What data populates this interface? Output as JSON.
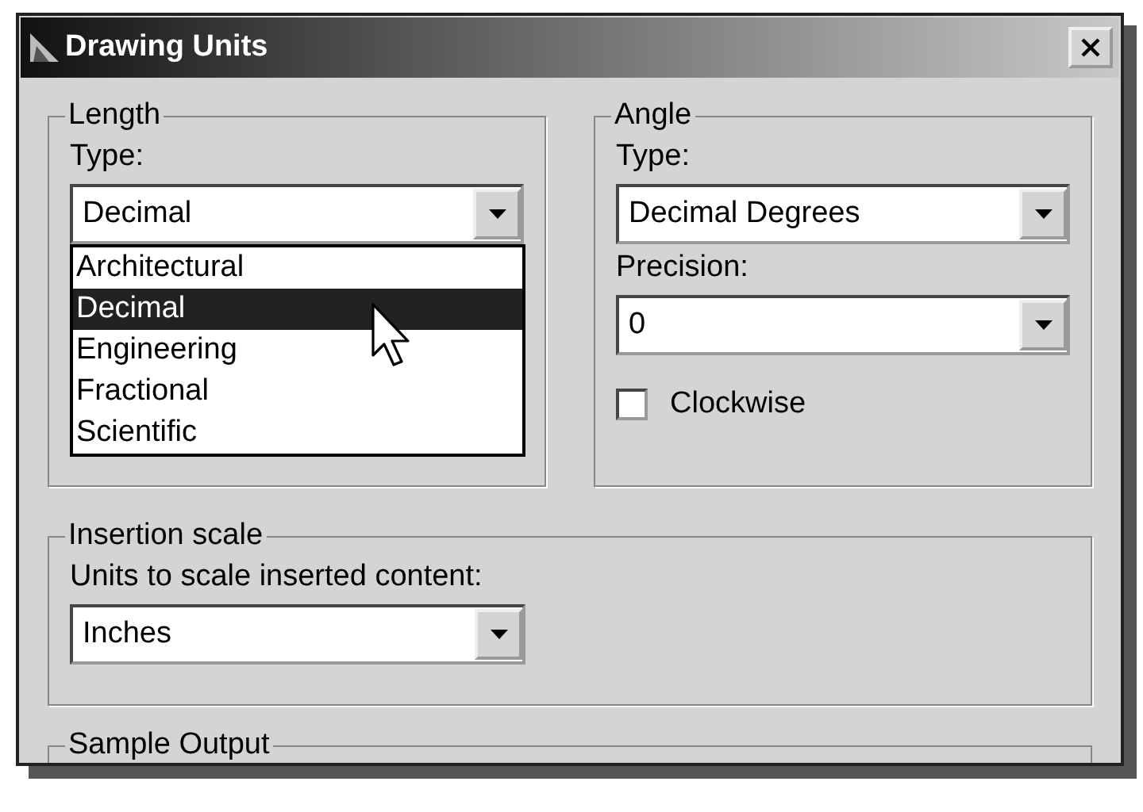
{
  "window": {
    "title": "Drawing Units"
  },
  "length": {
    "heading": "Length",
    "type_label": "Type:",
    "type_value": "Decimal",
    "list_open": true,
    "options": [
      {
        "label": "Architectural",
        "selected": false
      },
      {
        "label": "Decimal",
        "selected": true
      },
      {
        "label": "Engineering",
        "selected": false
      },
      {
        "label": "Fractional",
        "selected": false
      },
      {
        "label": "Scientific",
        "selected": false
      }
    ]
  },
  "angle": {
    "heading": "Angle",
    "type_label": "Type:",
    "type_value": "Decimal Degrees",
    "precision_label": "Precision:",
    "precision_value": "0",
    "clockwise": {
      "label": "Clockwise",
      "checked": false
    }
  },
  "insertion_scale": {
    "heading": "Insertion scale",
    "units_label": "Units to scale inserted content:",
    "units_value": "Inches"
  },
  "sample_output": {
    "heading": "Sample Output"
  }
}
